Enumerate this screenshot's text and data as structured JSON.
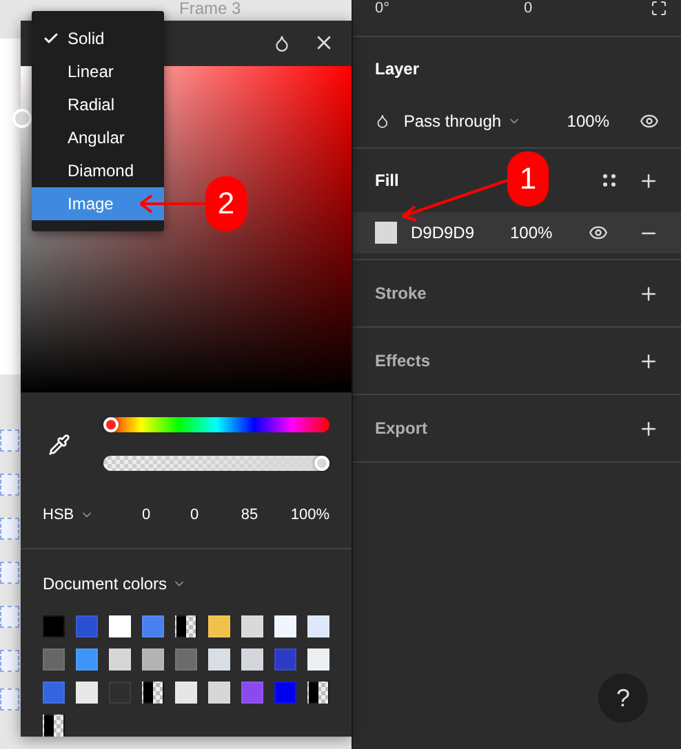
{
  "canvas": {
    "frame_label": "Frame 3"
  },
  "color_picker": {
    "fill_types": [
      {
        "label": "Solid",
        "checked": true,
        "selected": false
      },
      {
        "label": "Linear",
        "checked": false,
        "selected": false
      },
      {
        "label": "Radial",
        "checked": false,
        "selected": false
      },
      {
        "label": "Angular",
        "checked": false,
        "selected": false
      },
      {
        "label": "Diamond",
        "checked": false,
        "selected": false
      },
      {
        "label": "Image",
        "checked": false,
        "selected": true
      }
    ],
    "hue": {
      "level": 0
    },
    "opacity": {
      "level": 1
    },
    "color_model": "HSB",
    "values": [
      "0",
      "0",
      "85",
      "100%"
    ],
    "document_colors": {
      "title": "Document colors",
      "swatches": [
        {
          "kind": "solid",
          "color": "#000000"
        },
        {
          "kind": "solid",
          "color": "#2a4fd0"
        },
        {
          "kind": "solid",
          "color": "#ffffff"
        },
        {
          "kind": "solid",
          "color": "#4a80ee"
        },
        {
          "kind": "split",
          "color": "#000000"
        },
        {
          "kind": "solid",
          "color": "#f2c14b"
        },
        {
          "kind": "solid",
          "color": "#d9d9d9"
        },
        {
          "kind": "solid",
          "color": "#f0f6ff"
        },
        {
          "kind": "solid",
          "color": "#dde8fb"
        },
        {
          "kind": "solid",
          "color": "#666666"
        },
        {
          "kind": "solid",
          "color": "#3d96f7"
        },
        {
          "kind": "solid",
          "color": "#d6d6d6"
        },
        {
          "kind": "solid",
          "color": "#b3b3b3"
        },
        {
          "kind": "solid",
          "color": "#6b6b6b"
        },
        {
          "kind": "solid",
          "color": "#d8dde6"
        },
        {
          "kind": "solid",
          "color": "#d3d6db"
        },
        {
          "kind": "solid",
          "color": "#2b3bc6"
        },
        {
          "kind": "solid",
          "color": "#eceff2"
        },
        {
          "kind": "solid",
          "color": "#3464e0"
        },
        {
          "kind": "solid",
          "color": "#e8e8e8"
        },
        {
          "kind": "solid",
          "color": "#2e2e2e"
        },
        {
          "kind": "split",
          "color": "#000000"
        },
        {
          "kind": "solid",
          "color": "#e6e6e6"
        },
        {
          "kind": "solid",
          "color": "#d7d7d7"
        },
        {
          "kind": "solid",
          "color": "#8a4af0"
        },
        {
          "kind": "solid",
          "color": "#0000ee"
        },
        {
          "kind": "split",
          "color": "#000000"
        },
        {
          "kind": "split",
          "color": "#000000"
        }
      ]
    }
  },
  "properties": {
    "top_row": {
      "rotation": "0°",
      "radius": "0"
    },
    "layer": {
      "title": "Layer",
      "blend_mode": "Pass through",
      "opacity": "100%",
      "visible": true
    },
    "fill": {
      "title": "Fill",
      "items": [
        {
          "hex": "D9D9D9",
          "opacity": "100%",
          "visible": true
        }
      ]
    },
    "sections": [
      {
        "title": "Stroke"
      },
      {
        "title": "Effects"
      },
      {
        "title": "Export"
      }
    ]
  },
  "help": {
    "label": "?"
  },
  "annotations": [
    {
      "label": "1"
    },
    {
      "label": "2"
    }
  ]
}
